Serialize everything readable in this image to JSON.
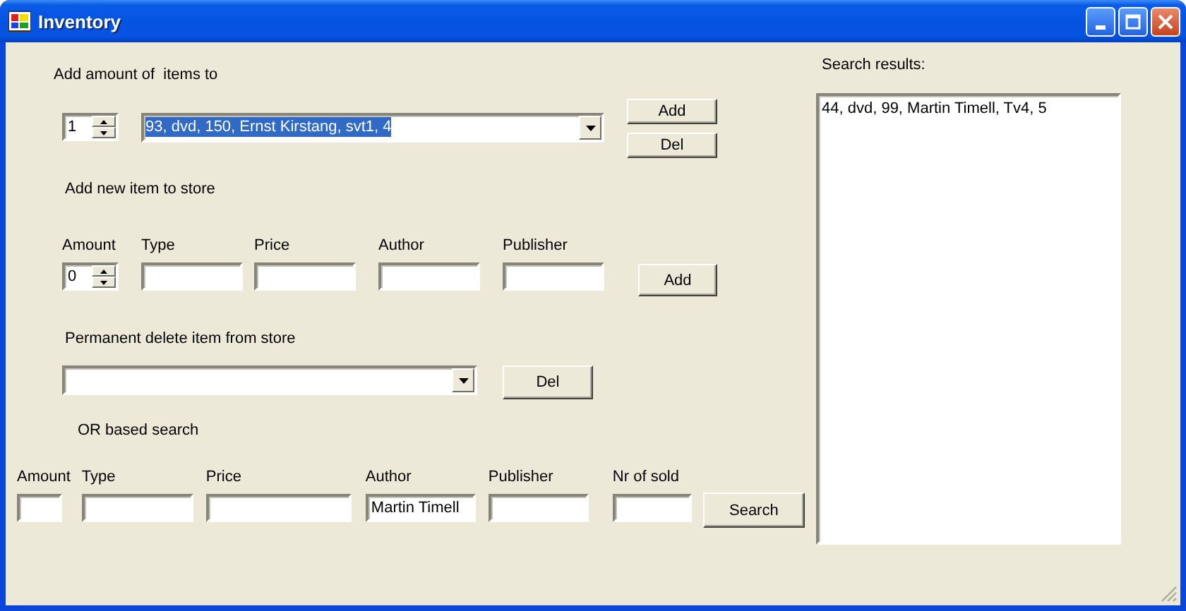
{
  "window": {
    "title": "Inventory"
  },
  "add_amount": {
    "label": "Add amount of  items to",
    "amount": "1",
    "item": "93, dvd, 150, Ernst Kirstang, svt1, 4",
    "item_selected": true,
    "buttons": [
      "Add",
      "Del"
    ]
  },
  "add_new": {
    "label": "Add new item to store",
    "fields": [
      {
        "label": "Amount",
        "kind": "spinner",
        "value": "0"
      },
      {
        "label": "Type",
        "kind": "text"
      },
      {
        "label": "Price",
        "kind": "text"
      },
      {
        "label": "Author",
        "kind": "text"
      },
      {
        "label": "Publisher",
        "kind": "text"
      }
    ],
    "button": "Add"
  },
  "delete": {
    "label": "Permanent delete item from store",
    "button": "Del"
  },
  "search": {
    "label": "OR based search",
    "fields": [
      {
        "label": "Amount",
        "kind": "text"
      },
      {
        "label": "Type",
        "kind": "text"
      },
      {
        "label": "Price",
        "kind": "text"
      },
      {
        "label": "Author",
        "kind": "text",
        "value": "Martin Timell"
      },
      {
        "label": "Publisher",
        "kind": "text"
      },
      {
        "label": "Nr of sold",
        "kind": "text"
      }
    ],
    "button": "Search"
  },
  "results": {
    "label": "Search results:",
    "items": [
      "44, dvd, 99, Martin Timell, Tv4, 5"
    ]
  }
}
